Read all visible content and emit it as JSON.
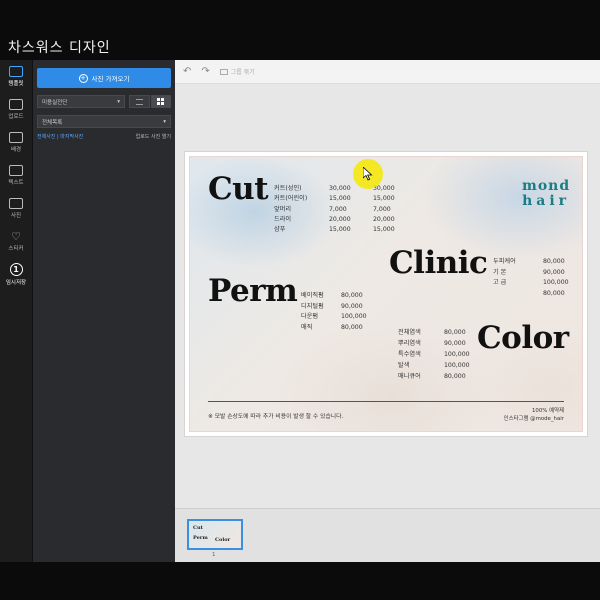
{
  "app": {
    "title": "차스워스 디자인"
  },
  "rail": {
    "items": [
      {
        "label": "템플릿",
        "icon": "template-icon"
      },
      {
        "label": "업로드",
        "icon": "upload-icon"
      },
      {
        "label": "배경",
        "icon": "background-icon"
      },
      {
        "label": "텍스트",
        "icon": "text-icon"
      },
      {
        "label": "사진",
        "icon": "photo-icon"
      },
      {
        "label": "스티커",
        "icon": "heart-icon"
      },
      {
        "label": "임시저장",
        "icon": "save-number-icon",
        "badge": "1"
      }
    ]
  },
  "panel": {
    "upload_label": "사진 가져오기",
    "filter_select": "미용실전단",
    "sort_select": "전체목록",
    "link_left": "전체사진 | 마지막사진",
    "link_right": "업로드 사진 열기"
  },
  "toolbar": {
    "group_label": "그룹 묶기"
  },
  "design": {
    "headings": {
      "cut": "Cut",
      "perm": "Perm",
      "clinic": "Clinic",
      "color": "Color"
    },
    "logo": {
      "line1": "mond",
      "line2": "hair"
    },
    "cut_rows": [
      [
        "커트(성인)",
        "30,000",
        "30,000"
      ],
      [
        "커트(어린이)",
        "15,000",
        "15,000"
      ],
      [
        "앞머리",
        "7,000",
        "7,000"
      ],
      [
        "드라이",
        "20,000",
        "20,000"
      ],
      [
        "샴푸",
        "15,000",
        "15,000"
      ]
    ],
    "perm_rows": [
      [
        "베이직펌",
        "80,000"
      ],
      [
        "디지털펌",
        "90,000"
      ],
      [
        "다운펌",
        "100,000"
      ],
      [
        "매직",
        "80,000"
      ]
    ],
    "clinic_rows": [
      [
        "두피케어",
        "80,000"
      ],
      [
        "기 본",
        "90,000"
      ],
      [
        "고 급",
        "100,000"
      ],
      [
        "",
        "80,000"
      ]
    ],
    "color_rows": [
      [
        "전체염색",
        "80,000"
      ],
      [
        "뿌리염색",
        "90,000"
      ],
      [
        "특수염색",
        "100,000"
      ],
      [
        "탈색",
        "100,000"
      ],
      [
        "매니큐어",
        "80,000"
      ]
    ],
    "note": "※ 모발 손상도에 따라 추가 비용이 발생 할 수 있습니다.",
    "footer_line1": "100% 예약제",
    "footer_line2": "인스타그램 @mode_hair"
  },
  "pages": {
    "thumb_number": "1"
  },
  "colors": {
    "accent": "#2f8be6",
    "logo": "#1b7d83",
    "cursor_highlight": "#f5e800"
  }
}
